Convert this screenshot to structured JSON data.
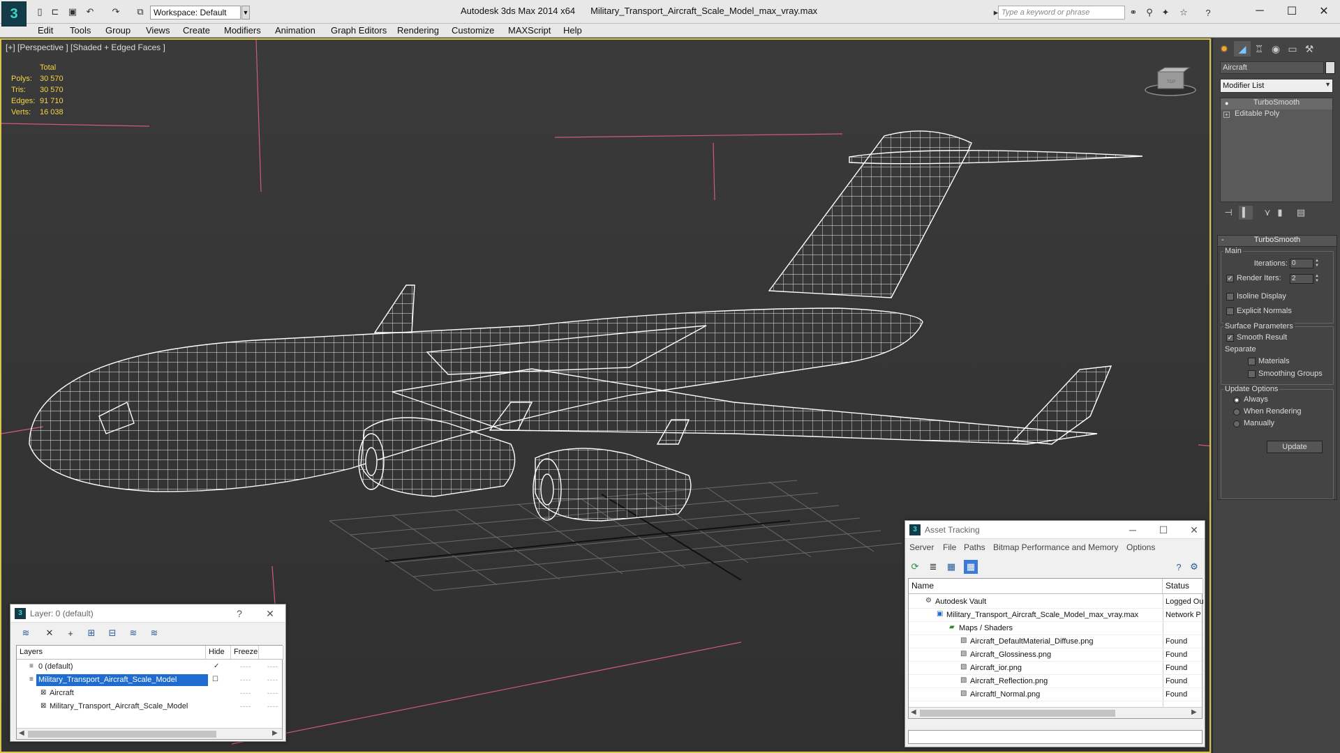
{
  "titlebar": {
    "app_name": "Autodesk 3ds Max  2014 x64",
    "file_name": "Military_Transport_Aircraft_Scale_Model_max_vray.max",
    "workspace": "Workspace: Default",
    "search_placeholder": "Type a keyword or phrase"
  },
  "menu": [
    "Edit",
    "Tools",
    "Group",
    "Views",
    "Create",
    "Modifiers",
    "Animation",
    "Graph Editors",
    "Rendering",
    "Customize",
    "MAXScript",
    "Help"
  ],
  "viewport": {
    "label": "[+] [Perspective ] [Shaded + Edged Faces ]",
    "stats_header": "Total",
    "stats": [
      {
        "key": "Polys:",
        "value": "30 570"
      },
      {
        "key": "Tris:",
        "value": "30 570"
      },
      {
        "key": "Edges:",
        "value": "91 710"
      },
      {
        "key": "Verts:",
        "value": "16 038"
      }
    ],
    "viewcube_label": "TOP"
  },
  "command_panel": {
    "object_name": "Aircraft",
    "modifier_list": "Modifier List",
    "stack": [
      "TurboSmooth",
      "Editable Poly"
    ],
    "rollout_title": "TurboSmooth",
    "main_group": "Main",
    "iterations_label": "Iterations:",
    "iterations_value": "0",
    "render_iters_label": "Render Iters:",
    "render_iters_value": "2",
    "isoline_label": "Isoline Display",
    "explicit_normals_label": "Explicit Normals",
    "surface_group": "Surface Parameters",
    "smooth_result_label": "Smooth Result",
    "separate_label": "Separate",
    "materials_label": "Materials",
    "smoothing_groups_label": "Smoothing Groups",
    "update_group": "Update Options",
    "always_label": "Always",
    "when_rendering_label": "When Rendering",
    "manually_label": "Manually",
    "update_button": "Update"
  },
  "layer_panel": {
    "title": "Layer: 0 (default)",
    "col_layers": "Layers",
    "col_hide": "Hide",
    "col_freeze": "Freeze",
    "rows": [
      {
        "name": "0 (default)"
      },
      {
        "name": "Military_Transport_Aircraft_Scale_Model"
      },
      {
        "name": "Aircraft"
      },
      {
        "name": "Military_Transport_Aircraft_Scale_Model"
      }
    ]
  },
  "asset_panel": {
    "title": "Asset Tracking",
    "menu": [
      "Server",
      "File",
      "Paths",
      "Bitmap Performance and Memory",
      "Options"
    ],
    "col_name": "Name",
    "col_status": "Status",
    "rows": [
      {
        "name": "Autodesk Vault",
        "status": "Logged Ou"
      },
      {
        "name": "Military_Transport_Aircraft_Scale_Model_max_vray.max",
        "status": "Network P"
      },
      {
        "name": "Maps / Shaders",
        "status": ""
      },
      {
        "name": "Aircraft_DefaultMaterial_Diffuse.png",
        "status": "Found"
      },
      {
        "name": "Aircraft_Glossiness.png",
        "status": "Found"
      },
      {
        "name": "Aircraft_ior.png",
        "status": "Found"
      },
      {
        "name": "Aircraft_Reflection.png",
        "status": "Found"
      },
      {
        "name": "Aircraftl_Normal.png",
        "status": "Found"
      }
    ]
  },
  "colors": {
    "viewport_border": "#d8c64a",
    "stats": "#f1d54a",
    "selection": "#1e6ccf",
    "app_accent": "#3fd5c8"
  }
}
